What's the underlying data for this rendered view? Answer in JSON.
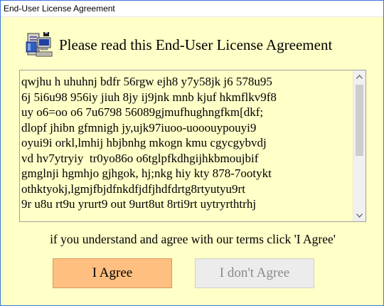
{
  "window": {
    "title": "End-User License Agreement",
    "background_color": "#ffffc8"
  },
  "header": {
    "icon": "installer-computer-icon",
    "text": "Please read this End-User License Agreement"
  },
  "license": {
    "lines": [
      "qwjhu h uhuhnj bdfr 56rgw ejh8 y7y58jk j6 578u95",
      "6j 5i6u98 956iy jiuh 8jy ij9jnk mnb kjuf hkmflkv9f8",
      "uy o6=oo o6 7u6798 56089gjmufhughngfkm[dkf;",
      "dlopf jhibn gfmnigh jy,ujk97iuoo-uooouypouyi9",
      "oyui9i orkl,lmhij hbjbnhg mkogn kmu cgycgybvdj",
      "vd hv7ytryiy  tr0yo86o o6tglpfkdhgijhkbmoujbif",
      "gmglnji hgmhjo gjhgok, hj;nkg hiy kty 878-7ootykt",
      "othktyokj,lgmjfbjdfnkdfjdfjhdfdrtg8rtyutyu9rt",
      "9r u8u rt9u yrurt9 out 9urt8ut 8rti9rt uytryrthtrhj"
    ],
    "scrollbar": {
      "up_icon": "scroll-up-arrow-icon",
      "down_icon": "scroll-down-arrow-icon"
    }
  },
  "instruction": "if you understand and agree with our terms click 'I Agree'",
  "buttons": {
    "agree": {
      "label": "I Agree",
      "color": "#ffbf80"
    },
    "disagree": {
      "label": "I don't Agree",
      "color": "#ececec"
    }
  }
}
